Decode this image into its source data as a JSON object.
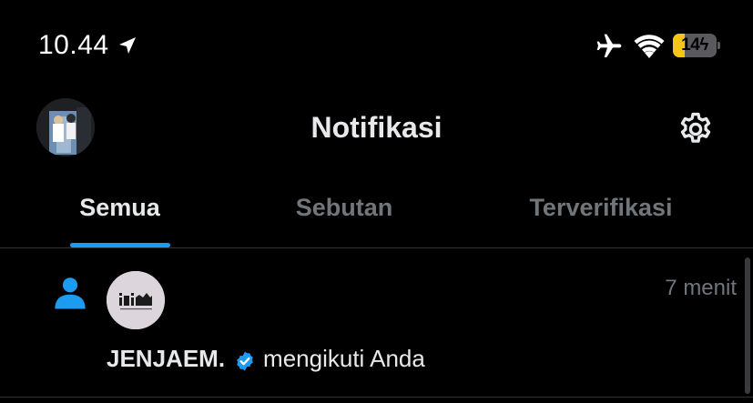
{
  "status_bar": {
    "time": "10.44",
    "battery_level": "14",
    "battery_fraction": 0.14,
    "battery_color": "#f5c518",
    "icons": [
      "location-arrow-icon",
      "airplane-icon",
      "wifi-icon",
      "battery-icon"
    ]
  },
  "header": {
    "title": "Notifikasi",
    "avatar_icon": "profile-avatar",
    "settings_icon": "gear-icon"
  },
  "tabs": [
    {
      "label": "Semua",
      "active": true
    },
    {
      "label": "Sebutan",
      "active": false
    },
    {
      "label": "Terverifikasi",
      "active": false
    }
  ],
  "accent_color": "#1d9bf0",
  "notifications": [
    {
      "type": "follow",
      "type_icon": "person-icon",
      "avatar_icon": "jenjaem-logo-avatar",
      "username": "JENJAEM.",
      "verified": true,
      "action": "mengikuti Anda",
      "time": "7 menit"
    }
  ]
}
